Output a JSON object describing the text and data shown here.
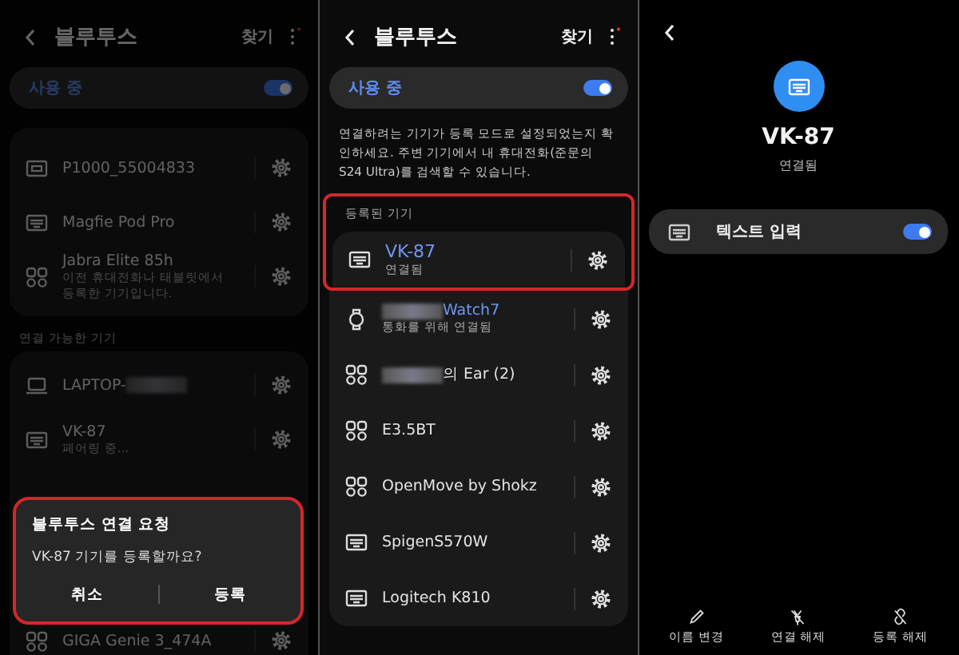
{
  "left_screen": {
    "dimmed": true,
    "title": "블루투스",
    "search": "찾기",
    "toggle": {
      "label": "사용 중",
      "on": true
    },
    "paired_devices": [
      {
        "kind": "tablet",
        "name": "P1000_55004833"
      },
      {
        "kind": "keyboard",
        "name": "Magfie Pod Pro"
      },
      {
        "kind": "buds",
        "name": "Jabra Elite 85h",
        "subtitle": "이전 휴대전화나 태블릿에서 등록한 기기입니다."
      }
    ],
    "available_heading": "연결 가능한 기기",
    "available_devices": [
      {
        "kind": "laptop",
        "name": "LAPTOP-",
        "blurred_suffix": true
      },
      {
        "kind": "keyboard",
        "name": "VK-87",
        "subtitle": "페어링 중..."
      }
    ],
    "covered_devices": [
      {
        "kind": "buds",
        "name": "GIGA Genie 3_474A"
      }
    ],
    "dialog": {
      "highlighted": true,
      "title": "블루투스 연결 요청",
      "message": "VK-87 기기를 등록할까요?",
      "buttons": [
        "취소",
        "등록"
      ]
    }
  },
  "middle_screen": {
    "title": "블루투스",
    "search": "찾기",
    "toggle": {
      "label": "사용 중",
      "on": true
    },
    "description": "연결하려는 기기가 등록 모드로 설정되었는지 확인하세요. 주변 기기에서 내 휴대전화(준문의 S24 Ultra)를 검색할 수 있습니다.",
    "section_heading": "등록된 기기",
    "devices": [
      {
        "kind": "keyboard",
        "name": "VK-87",
        "subtitle": "연결됨",
        "active": true,
        "highlighted": true
      },
      {
        "kind": "watch",
        "name": "Watch7",
        "subtitle": "통화를 위해 연결됨",
        "active": true,
        "highlighted": false,
        "blurred_prefix": true
      },
      {
        "kind": "buds",
        "name": "의 Ear (2)",
        "active": false,
        "highlighted": false,
        "blurred_prefix": true
      },
      {
        "kind": "buds",
        "name": "E3.5BT",
        "active": false,
        "highlighted": false
      },
      {
        "kind": "buds",
        "name": "OpenMove by Shokz",
        "active": false,
        "highlighted": false
      },
      {
        "kind": "keyboard",
        "name": "SpigenS570W",
        "active": false,
        "highlighted": false
      },
      {
        "kind": "keyboard",
        "name": "Logitech K810",
        "active": false,
        "highlighted": false
      }
    ]
  },
  "right_screen": {
    "device_name": "VK-87",
    "status": "연결됨",
    "setting": {
      "label": "텍스트 입력",
      "on": true
    },
    "actions": [
      {
        "kind": "pencil",
        "label": "이름 변경"
      },
      {
        "kind": "unplug",
        "label": "연결 해제"
      },
      {
        "kind": "unlink",
        "label": "등록 해제"
      }
    ]
  }
}
